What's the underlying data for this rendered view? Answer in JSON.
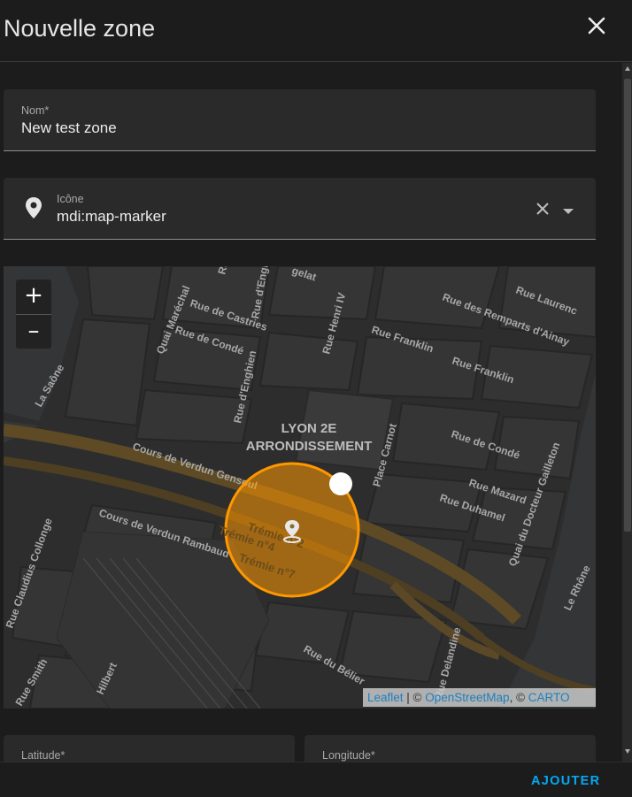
{
  "dialog": {
    "title": "Nouvelle zone"
  },
  "name_field": {
    "label": "Nom*",
    "value": "New test zone"
  },
  "icon_field": {
    "label": "Icône",
    "value": "mdi:map-marker"
  },
  "map": {
    "zoom_in": "+",
    "zoom_out": "–",
    "district": [
      "LYON 2E",
      "ARRONDISSEMENT"
    ],
    "streets": [
      "Quai Maréchal",
      "Rue de Castries",
      "Rue d'Enghien",
      "Rue Henri IV",
      "Rue des Remparts d'Ainay",
      "Rue Laurenc",
      "Rue de Condé",
      "Rue Franklin",
      "Rue d'Enghien",
      "Rue Franklin",
      "La Saône",
      "Cours de Verdun Gensoul",
      "Place Carnot",
      "Rue de Condé",
      "Quai du Docteur Gailleton",
      "Rue Mazard",
      "Rue Duhamel",
      "Cours de Verdun Rambaud",
      "Trémie n°2",
      "Trémie n°4",
      "Trémie n°7",
      "Le Rhône",
      "Rue Claudius Collonge",
      "Rue du Bélier",
      "Rue Delandine",
      "Hilbert",
      "Rue Smith",
      "gelat",
      "Rue Po"
    ],
    "attribution": {
      "leaflet": "Leaflet",
      "sep1": " | © ",
      "osm": "OpenStreetMap",
      "sep2": ", © ",
      "carto": "CARTO"
    }
  },
  "latitude_field": {
    "label": "Latitude*"
  },
  "longitude_field": {
    "label": "Longitude*"
  },
  "footer": {
    "add_label": "AJOUTER"
  },
  "colors": {
    "accent": "#03a9f4",
    "zone": "#ff9800",
    "background": "#1c1c1c",
    "field": "#2a2a2a"
  }
}
